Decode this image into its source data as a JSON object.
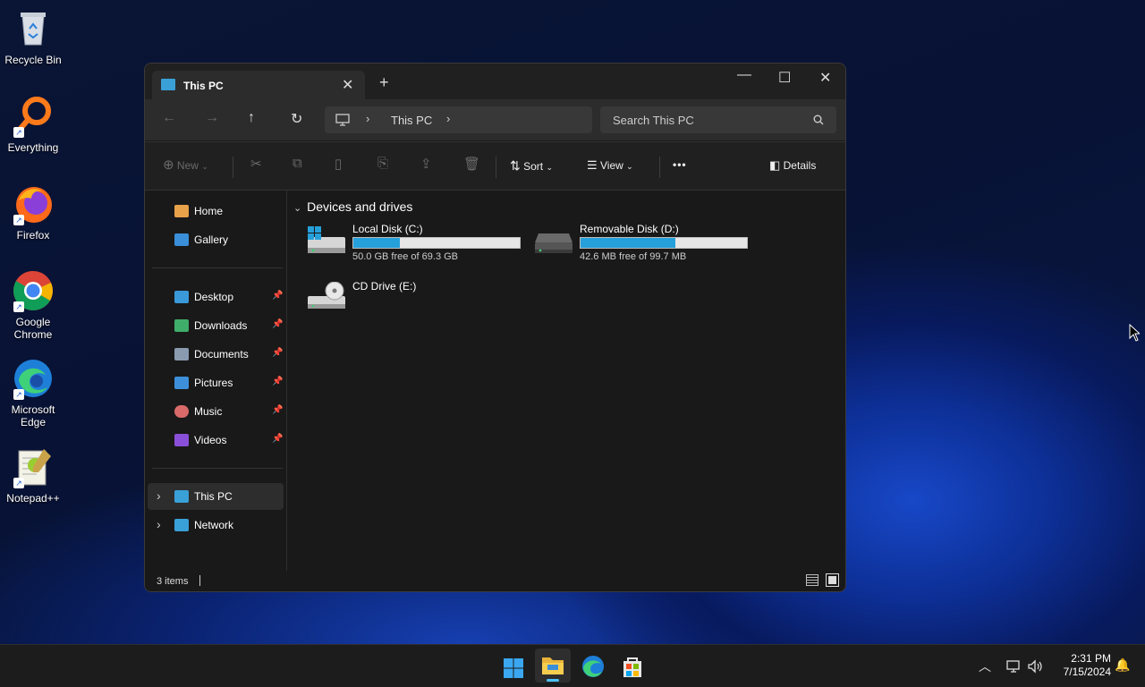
{
  "desktop": {
    "icons": [
      {
        "name": "recycle-bin",
        "label": "Recycle Bin"
      },
      {
        "name": "everything",
        "label": "Everything"
      },
      {
        "name": "firefox",
        "label": "Firefox"
      },
      {
        "name": "google-chrome",
        "label": "Google Chrome"
      },
      {
        "name": "microsoft-edge",
        "label": "Microsoft Edge"
      },
      {
        "name": "notepadpp",
        "label": "Notepad++"
      }
    ]
  },
  "window": {
    "tab_title": "This PC",
    "new_tab": "+",
    "controls": {
      "minimize": "—",
      "maximize": "☐",
      "close": "✕"
    },
    "address": {
      "location": "This PC"
    },
    "search": {
      "placeholder": "Search This PC"
    },
    "commands": {
      "new": "New",
      "sort": "Sort",
      "view": "View",
      "more": "•••",
      "details": "Details"
    },
    "sidebar": {
      "quick": [
        {
          "label": "Home",
          "color": "#e8a24a"
        },
        {
          "label": "Gallery",
          "color": "#3a8fd8"
        }
      ],
      "pinned": [
        {
          "label": "Desktop",
          "color": "#3a9ad9"
        },
        {
          "label": "Downloads",
          "color": "#3fae6b"
        },
        {
          "label": "Documents",
          "color": "#8a9bb0"
        },
        {
          "label": "Pictures",
          "color": "#3d8fd9"
        },
        {
          "label": "Music",
          "color": "#d86a6a"
        },
        {
          "label": "Videos",
          "color": "#8a4fd8"
        }
      ],
      "locations": [
        {
          "label": "This PC",
          "color": "#3aa0d8",
          "selected": true
        },
        {
          "label": "Network",
          "color": "#3aa0d8",
          "selected": false
        }
      ]
    },
    "content": {
      "group_title": "Devices and drives",
      "drives": [
        {
          "name": "Local Disk (C:)",
          "free_text": "50.0 GB free of 69.3 GB",
          "used_fraction": 0.28
        },
        {
          "name": "Removable Disk (D:)",
          "free_text": "42.6 MB free of 99.7 MB",
          "used_fraction": 0.57
        },
        {
          "name": "CD Drive (E:)"
        }
      ]
    },
    "status": {
      "items": "3 items"
    }
  },
  "taskbar": {
    "clock": {
      "time": "2:31 PM",
      "date": "7/15/2024"
    }
  }
}
